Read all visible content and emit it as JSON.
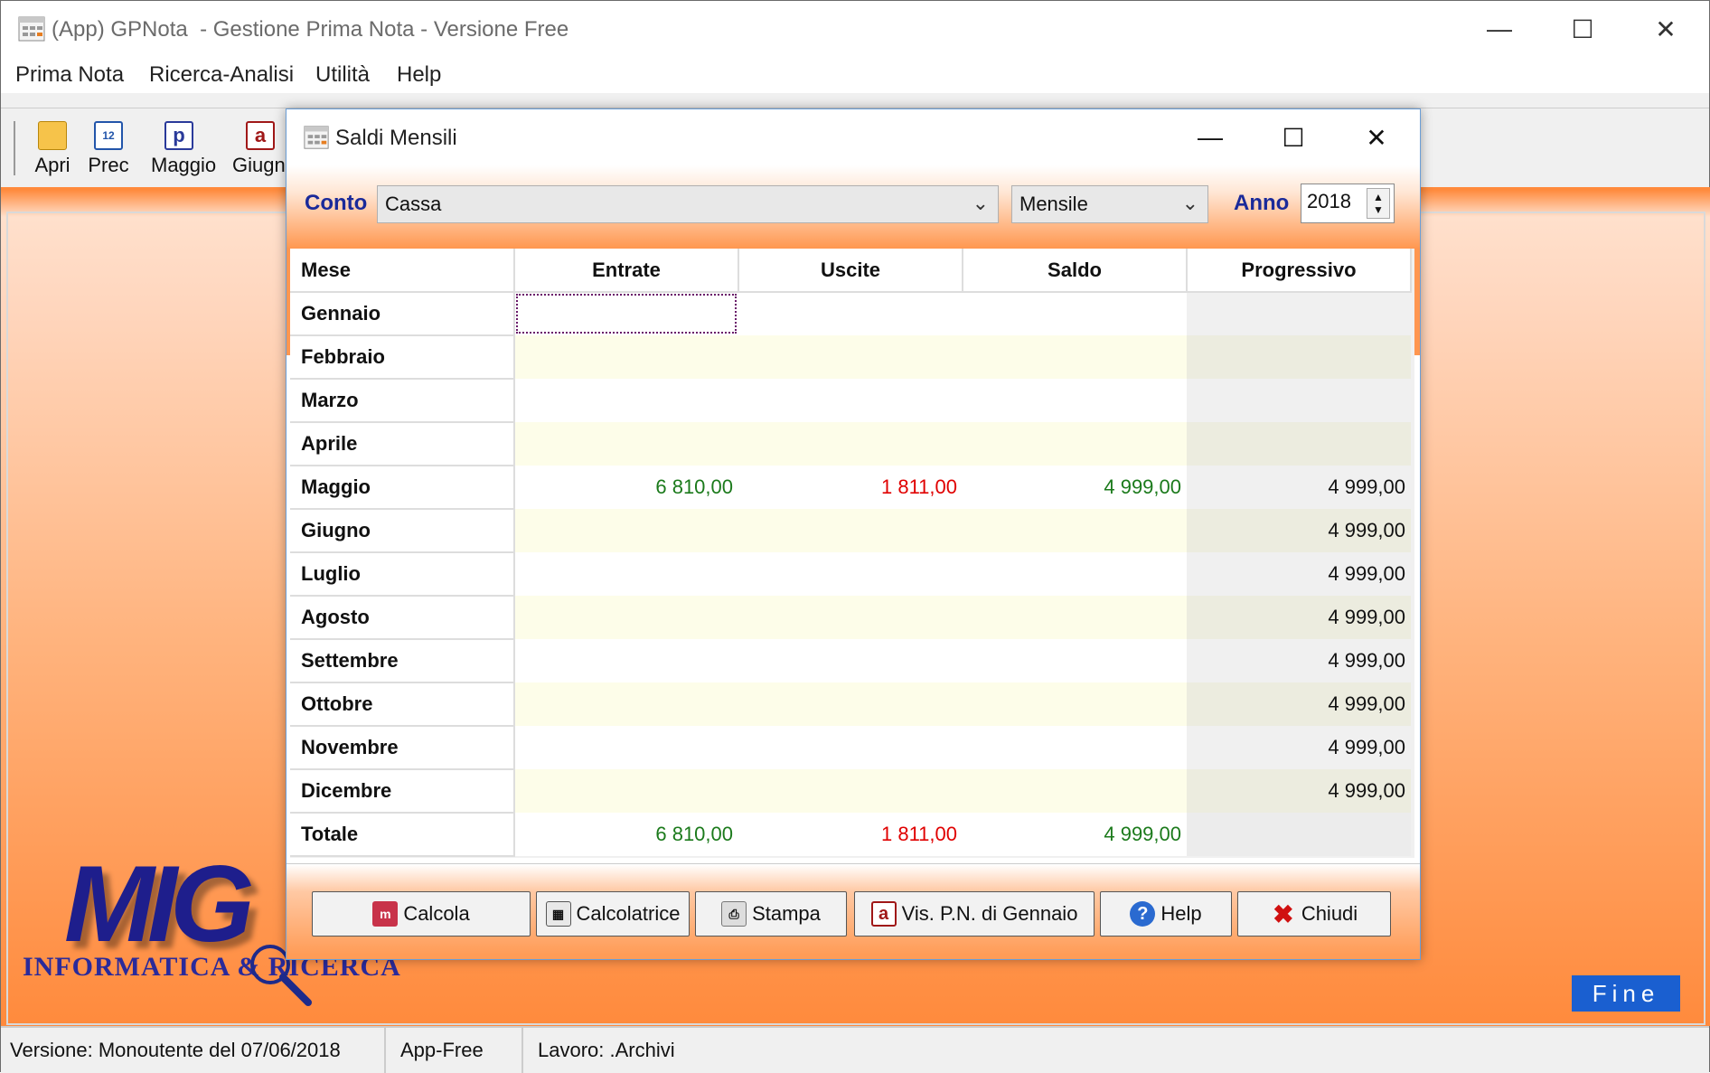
{
  "app": {
    "title": "(App) GPNota  - Gestione Prima Nota - Versione Free",
    "menu": [
      "Prima Nota",
      "Ricerca-Analisi",
      "Utilità",
      "Help"
    ],
    "toolbar": [
      {
        "label": "Apri",
        "icon": "folder-icon"
      },
      {
        "label": "Prec",
        "icon": "calendar-icon"
      },
      {
        "label": "Maggio",
        "icon": "p-icon"
      },
      {
        "label": "Giugno",
        "icon": "a-icon"
      }
    ],
    "fine_label": "Fine",
    "logo": {
      "mark": "MIG",
      "text": "INFORMATICA & RICERCA"
    }
  },
  "statusbar": {
    "version": "Versione: Monoutente del 07/06/2018",
    "edition": "App-Free",
    "work": "Lavoro: .Archivi"
  },
  "dialog": {
    "title": "Saldi Mensili",
    "conto_label": "Conto",
    "conto_value": "Cassa",
    "period_value": "Mensile",
    "anno_label": "Anno",
    "anno_value": "2018",
    "columns": [
      "Mese",
      "Entrate",
      "Uscite",
      "Saldo",
      "Progressivo"
    ],
    "rows": [
      {
        "mese": "Gennaio",
        "entrate": "",
        "uscite": "",
        "saldo": "",
        "progressivo": ""
      },
      {
        "mese": "Febbraio",
        "entrate": "",
        "uscite": "",
        "saldo": "",
        "progressivo": ""
      },
      {
        "mese": "Marzo",
        "entrate": "",
        "uscite": "",
        "saldo": "",
        "progressivo": ""
      },
      {
        "mese": "Aprile",
        "entrate": "",
        "uscite": "",
        "saldo": "",
        "progressivo": ""
      },
      {
        "mese": "Maggio",
        "entrate": "6 810,00",
        "uscite": "1 811,00",
        "saldo": "4 999,00",
        "progressivo": "4 999,00"
      },
      {
        "mese": "Giugno",
        "entrate": "",
        "uscite": "",
        "saldo": "",
        "progressivo": "4 999,00"
      },
      {
        "mese": "Luglio",
        "entrate": "",
        "uscite": "",
        "saldo": "",
        "progressivo": "4 999,00"
      },
      {
        "mese": "Agosto",
        "entrate": "",
        "uscite": "",
        "saldo": "",
        "progressivo": "4 999,00"
      },
      {
        "mese": "Settembre",
        "entrate": "",
        "uscite": "",
        "saldo": "",
        "progressivo": "4 999,00"
      },
      {
        "mese": "Ottobre",
        "entrate": "",
        "uscite": "",
        "saldo": "",
        "progressivo": "4 999,00"
      },
      {
        "mese": "Novembre",
        "entrate": "",
        "uscite": "",
        "saldo": "",
        "progressivo": "4 999,00"
      },
      {
        "mese": "Dicembre",
        "entrate": "",
        "uscite": "",
        "saldo": "",
        "progressivo": "4 999,00"
      }
    ],
    "totale": {
      "mese": "Totale",
      "entrate": "6 810,00",
      "uscite": "1 811,00",
      "saldo": "4 999,00",
      "progressivo": ""
    },
    "buttons": [
      {
        "label": "Calcola",
        "icon": "calculate-icon"
      },
      {
        "label": "Calcolatrice",
        "icon": "calculator-icon"
      },
      {
        "label": "Stampa",
        "icon": "printer-icon"
      },
      {
        "label": "Vis. P.N. di Gennaio",
        "icon": "a-icon"
      },
      {
        "label": "Help",
        "icon": "help-icon"
      },
      {
        "label": "Chiudi",
        "icon": "close-x-icon"
      }
    ],
    "colors": {
      "positive": "#1b7a1b",
      "negative": "#e00000",
      "accent_orange": "#ff8a3c",
      "label_blue": "#1a2a9a"
    }
  }
}
